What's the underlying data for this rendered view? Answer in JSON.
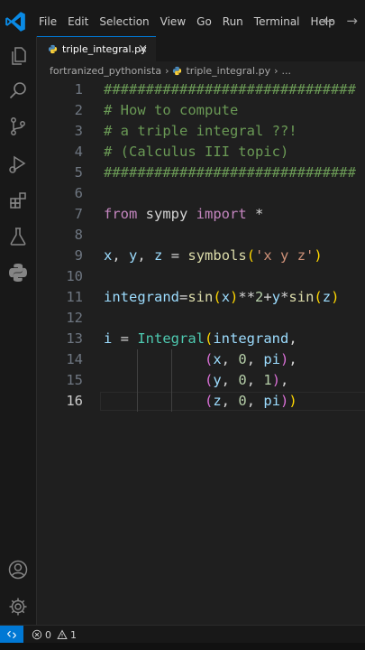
{
  "menu": [
    "File",
    "Edit",
    "Selection",
    "View",
    "Go",
    "Run",
    "Terminal",
    "Help"
  ],
  "nav": {
    "back": "←",
    "forward": "→"
  },
  "tab": {
    "label": "triple_integral.py",
    "close": "×"
  },
  "breadcrumb": {
    "folder": "fortranized_pythonista",
    "file": "triple_integral.py",
    "more": "..."
  },
  "lines": [
    {
      "n": "1",
      "tokens": [
        {
          "t": "##############################",
          "c": "comment"
        }
      ]
    },
    {
      "n": "2",
      "tokens": [
        {
          "t": "# How to compute",
          "c": "comment"
        }
      ]
    },
    {
      "n": "3",
      "tokens": [
        {
          "t": "# a triple integral ??!",
          "c": "comment"
        }
      ]
    },
    {
      "n": "4",
      "tokens": [
        {
          "t": "# (Calculus III topic)",
          "c": "comment"
        }
      ]
    },
    {
      "n": "5",
      "tokens": [
        {
          "t": "##############################",
          "c": "comment"
        }
      ]
    },
    {
      "n": "6",
      "tokens": []
    },
    {
      "n": "7",
      "tokens": [
        {
          "t": "from",
          "c": "kw"
        },
        {
          "t": " sympy ",
          "c": "op"
        },
        {
          "t": "import",
          "c": "kw"
        },
        {
          "t": " *",
          "c": "op"
        }
      ]
    },
    {
      "n": "8",
      "tokens": []
    },
    {
      "n": "9",
      "tokens": [
        {
          "t": "x",
          "c": "var"
        },
        {
          "t": ", ",
          "c": "op"
        },
        {
          "t": "y",
          "c": "var"
        },
        {
          "t": ", ",
          "c": "op"
        },
        {
          "t": "z",
          "c": "var"
        },
        {
          "t": " = ",
          "c": "op"
        },
        {
          "t": "symbols",
          "c": "fn"
        },
        {
          "t": "(",
          "c": "b1"
        },
        {
          "t": "'x y z'",
          "c": "str"
        },
        {
          "t": ")",
          "c": "b1"
        }
      ]
    },
    {
      "n": "10",
      "tokens": []
    },
    {
      "n": "11",
      "tokens": [
        {
          "t": "integrand",
          "c": "var"
        },
        {
          "t": "=",
          "c": "op"
        },
        {
          "t": "sin",
          "c": "fn"
        },
        {
          "t": "(",
          "c": "b1"
        },
        {
          "t": "x",
          "c": "var"
        },
        {
          "t": ")",
          "c": "b1"
        },
        {
          "t": "**",
          "c": "op"
        },
        {
          "t": "2",
          "c": "num"
        },
        {
          "t": "+",
          "c": "op"
        },
        {
          "t": "y",
          "c": "var"
        },
        {
          "t": "*",
          "c": "op"
        },
        {
          "t": "sin",
          "c": "fn"
        },
        {
          "t": "(",
          "c": "b1"
        },
        {
          "t": "z",
          "c": "var"
        },
        {
          "t": ")",
          "c": "b1"
        }
      ]
    },
    {
      "n": "12",
      "tokens": []
    },
    {
      "n": "13",
      "tokens": [
        {
          "t": "i",
          "c": "var"
        },
        {
          "t": " = ",
          "c": "op"
        },
        {
          "t": "Integral",
          "c": "cls"
        },
        {
          "t": "(",
          "c": "b1"
        },
        {
          "t": "integrand",
          "c": "var"
        },
        {
          "t": ",",
          "c": "op"
        }
      ]
    },
    {
      "n": "14",
      "tokens": [
        {
          "t": "            ",
          "c": "op"
        },
        {
          "t": "(",
          "c": "b2"
        },
        {
          "t": "x",
          "c": "var"
        },
        {
          "t": ", ",
          "c": "op"
        },
        {
          "t": "0",
          "c": "num"
        },
        {
          "t": ", ",
          "c": "op"
        },
        {
          "t": "pi",
          "c": "var"
        },
        {
          "t": ")",
          "c": "b2"
        },
        {
          "t": ",",
          "c": "op"
        }
      ]
    },
    {
      "n": "15",
      "tokens": [
        {
          "t": "            ",
          "c": "op"
        },
        {
          "t": "(",
          "c": "b2"
        },
        {
          "t": "y",
          "c": "var"
        },
        {
          "t": ", ",
          "c": "op"
        },
        {
          "t": "0",
          "c": "num"
        },
        {
          "t": ", ",
          "c": "op"
        },
        {
          "t": "1",
          "c": "num"
        },
        {
          "t": ")",
          "c": "b2"
        },
        {
          "t": ",",
          "c": "op"
        }
      ]
    },
    {
      "n": "16",
      "tokens": [
        {
          "t": "            ",
          "c": "op"
        },
        {
          "t": "(",
          "c": "b2"
        },
        {
          "t": "z",
          "c": "var"
        },
        {
          "t": ", ",
          "c": "op"
        },
        {
          "t": "0",
          "c": "num"
        },
        {
          "t": ", ",
          "c": "op"
        },
        {
          "t": "pi",
          "c": "var"
        },
        {
          "t": ")",
          "c": "b2"
        },
        {
          "t": ")",
          "c": "b1"
        }
      ]
    }
  ],
  "active_line": "16",
  "status": {
    "errors": "0",
    "warnings": "1"
  },
  "icons": {
    "activity_bar": [
      "explorer-icon",
      "search-icon",
      "source-control-icon",
      "run-debug-icon",
      "extensions-icon",
      "testing-icon",
      "python-icon"
    ],
    "bottom": [
      "account-icon",
      "manage-gear-icon"
    ]
  },
  "colors": {
    "accent": "#0078d4",
    "background": "#1f1f1f",
    "comment": "#6a9955",
    "keyword": "#c586c0"
  }
}
